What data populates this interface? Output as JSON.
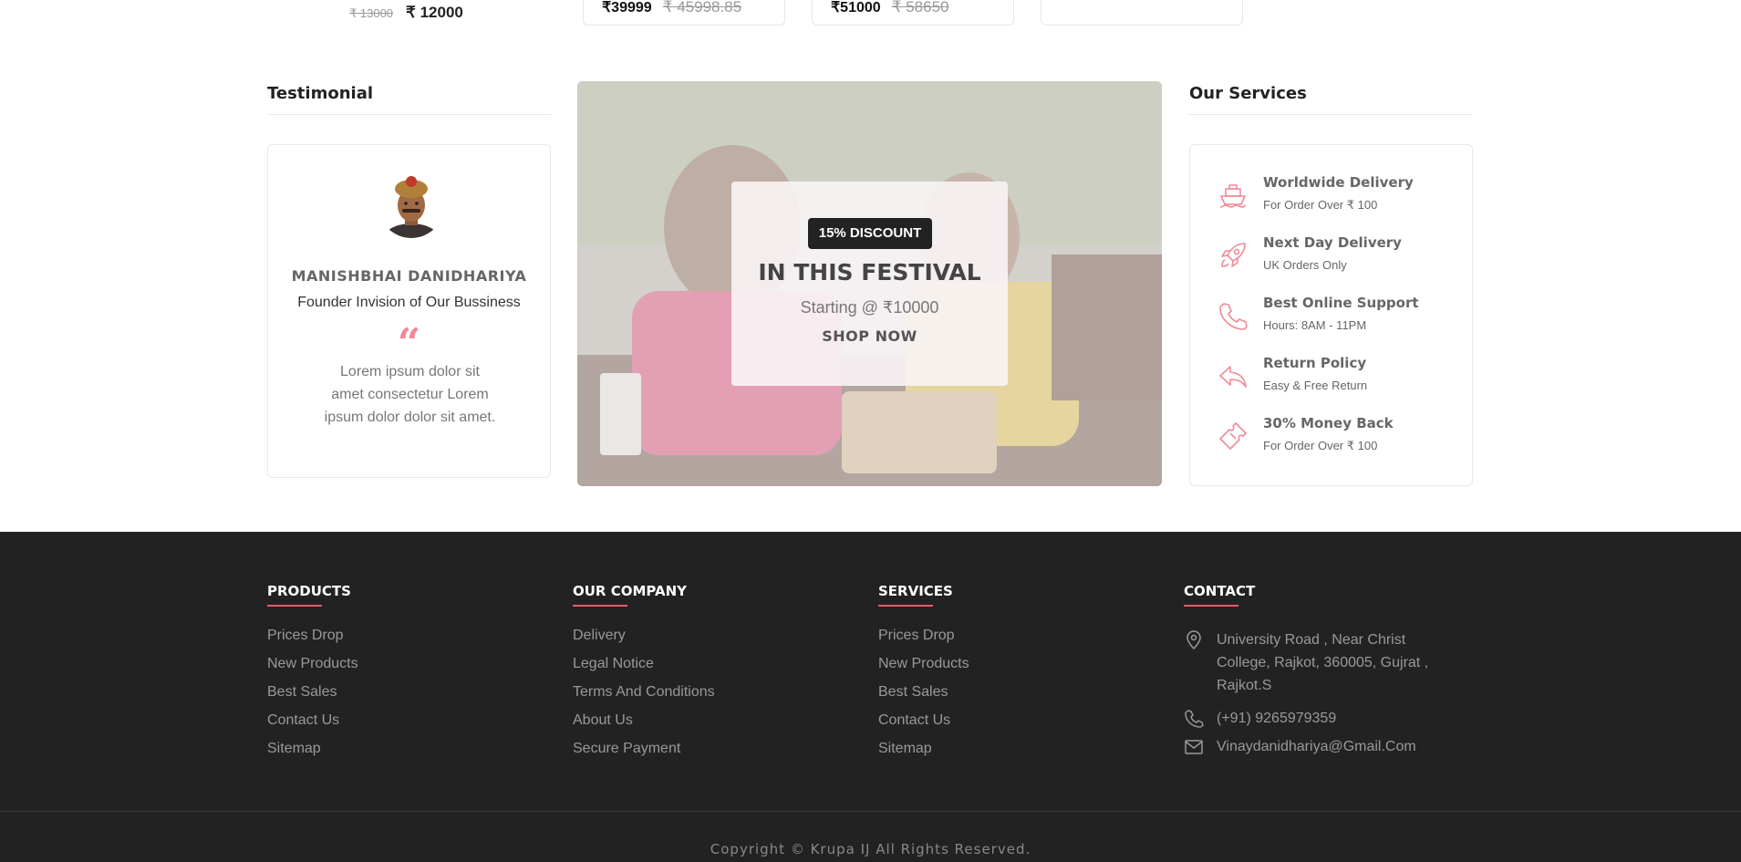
{
  "top_prices": {
    "item1": {
      "old": "₹ 13000",
      "new": "₹ 12000"
    },
    "item2": {
      "new": "₹39999",
      "old": "₹ 45998.85"
    },
    "item3": {
      "new": "₹51000",
      "old": "₹ 58650"
    }
  },
  "testimonial": {
    "heading": "Testimonial",
    "name": "MANISHBHAI DANIDHARIYA",
    "role": "Founder Invision of Our Bussiness",
    "quote_mark": "“",
    "text": "Lorem ipsum dolor sit amet consectetur Lorem ipsum dolor dolor sit amet."
  },
  "banner": {
    "badge": "15% DISCOUNT",
    "title": "IN THIS FESTIVAL",
    "subtitle": "Starting @ ₹10000",
    "cta": "SHOP NOW"
  },
  "services": {
    "heading": "Our Services",
    "items": [
      {
        "icon": "ship-icon",
        "title": "Worldwide Delivery",
        "sub": "For Order Over ₹ 100"
      },
      {
        "icon": "rocket-icon",
        "title": "Next Day Delivery",
        "sub": "UK Orders Only"
      },
      {
        "icon": "phone-icon",
        "title": "Best Online Support",
        "sub": "Hours: 8AM - 11PM"
      },
      {
        "icon": "return-arrow-icon",
        "title": "Return Policy",
        "sub": "Easy & Free Return"
      },
      {
        "icon": "ticket-icon",
        "title": "30% Money Back",
        "sub": "For Order Over ₹ 100"
      }
    ]
  },
  "footer": {
    "products": {
      "title": "PRODUCTS",
      "links": [
        "Prices Drop",
        "New Products",
        "Best Sales",
        "Contact Us",
        "Sitemap"
      ]
    },
    "company": {
      "title": "OUR COMPANY",
      "links": [
        "Delivery",
        "Legal Notice",
        "Terms And Conditions",
        "About Us",
        "Secure Payment"
      ]
    },
    "services": {
      "title": "SERVICES",
      "links": [
        "Prices Drop",
        "New Products",
        "Best Sales",
        "Contact Us",
        "Sitemap"
      ]
    },
    "contact": {
      "title": "CONTACT",
      "address": "University Road , Near Christ College, Rajkot, 360005, Gujrat , Rajkot.S",
      "phone": "(+91) 9265979359",
      "email": "Vinaydanidhariya@Gmail.Com"
    },
    "copyright": "Copyright © Krupa IJ All Rights Reserved."
  },
  "colors": {
    "accent": "#e85a6b",
    "footer_bg": "#222222",
    "icon_pink": "#f08a96"
  }
}
